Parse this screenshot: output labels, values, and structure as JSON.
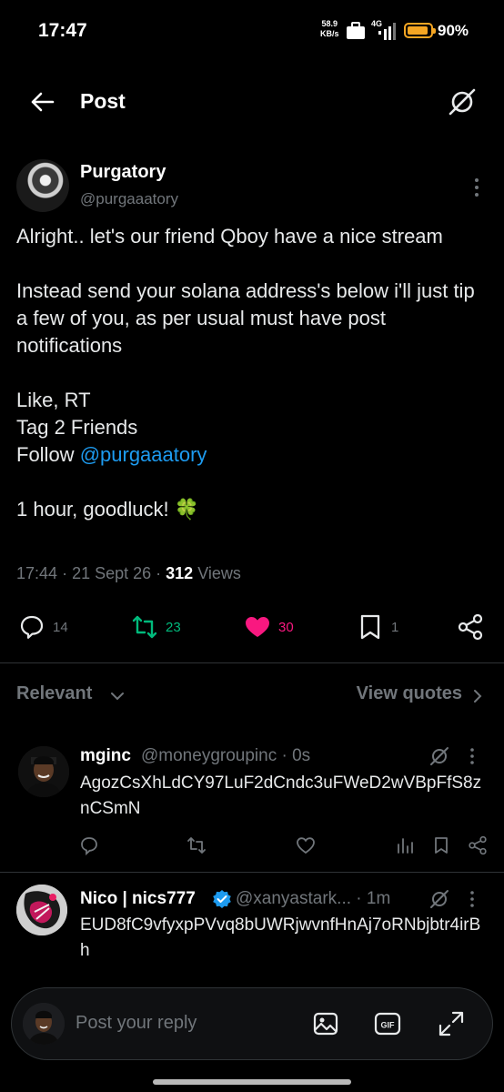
{
  "status_bar": {
    "time": "17:47",
    "speed_value": "58.9",
    "speed_unit": "KB/s",
    "network": "4G",
    "battery": "90%",
    "battery_color": "#f5a623"
  },
  "header": {
    "title": "Post"
  },
  "post": {
    "author_name": "Purgatory",
    "author_handle": "@purgaaatory",
    "lines": [
      "Alright.. let's our friend Qboy have a nice stream",
      "Instead send your solana address's below i'll just tip a few of you, as per usual must have post notifications",
      "Like, RT",
      "Tag 2 Friends",
      "Follow "
    ],
    "mention": "@purgaaatory",
    "closing": "1 hour, goodluck! 🍀",
    "time": "17:44",
    "date": "21 Sept 26",
    "views_count": "312",
    "views_label": "Views",
    "stats": {
      "replies": "14",
      "reposts": "23",
      "likes": "30",
      "bookmarks": "1"
    },
    "colors": {
      "repost": "#00ba7c",
      "like": "#f91880",
      "mention": "#1d9bf0"
    }
  },
  "filters": {
    "sort_label": "Relevant",
    "quotes_label": "View quotes"
  },
  "replies": [
    {
      "name": "mginc",
      "handle": "@moneygroupinc",
      "time": "· 0s",
      "text": "AgozCsXhLdCY97LuF2dCndc3uFWeD2wVBpFfS8znCSmN"
    },
    {
      "name": "Nico | nics777",
      "handle": "@xanyastark...",
      "time": "· 1m",
      "verified": true,
      "text": "EUD8fC9vfyxpPVvq8bUWRjwvnfHnAj7oRNbjbtr4irBh"
    }
  ],
  "compose": {
    "placeholder": "Post your reply"
  }
}
